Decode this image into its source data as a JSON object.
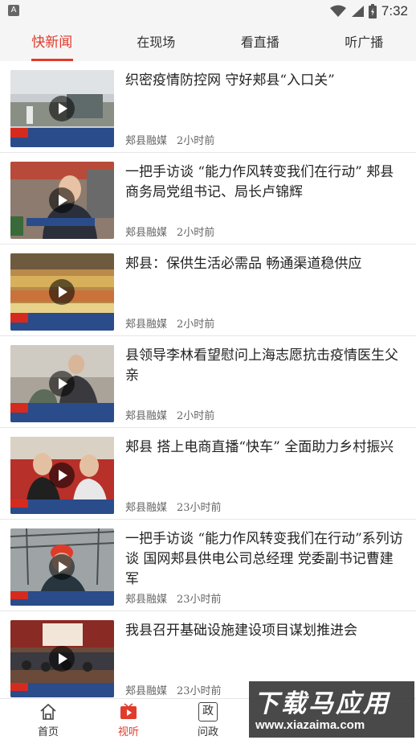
{
  "status_bar": {
    "time": "7:32",
    "left_icon": "A"
  },
  "tabs": [
    {
      "label": "快新闻",
      "active": true
    },
    {
      "label": "在现场",
      "active": false
    },
    {
      "label": "看直播",
      "active": false
    },
    {
      "label": "听广播",
      "active": false
    }
  ],
  "news": [
    {
      "title": "织密疫情防控网 守好郏县“入口关”",
      "source": "郏县融媒",
      "time": "2小时前"
    },
    {
      "title": "一把手访谈 “能力作风转变我们在行动” 郏县商务局党组书记、局长卢锦辉",
      "source": "郏县融媒",
      "time": "2小时前"
    },
    {
      "title": "郏县：保供生活必需品 畅通渠道稳供应",
      "source": "郏县融媒",
      "time": "2小时前"
    },
    {
      "title": "县领导李林看望慰问上海志愿抗击疫情医生父亲",
      "source": "郏县融媒",
      "time": "2小时前"
    },
    {
      "title": " 郏县 搭上电商直播“快车” 全面助力乡村振兴",
      "source": "郏县融媒",
      "time": "23小时前"
    },
    {
      "title": "一把手访谈 “能力作风转变我们在行动”系列访谈 国网郏县供电公司总经理 党委副书记曹建军",
      "source": "郏县融媒",
      "time": "23小时前"
    },
    {
      "title": "我县召开基础设施建设项目谋划推进会",
      "source": "郏县融媒",
      "time": "23小时前"
    }
  ],
  "bottom_nav": [
    {
      "label": "首页",
      "icon": "home-icon"
    },
    {
      "label": "视听",
      "icon": "video-icon",
      "active": true
    },
    {
      "label": "问政",
      "icon": "politics-icon",
      "glyph": "政"
    }
  ],
  "watermark": {
    "main": "下载马应用",
    "url": "www.xiazaima.com"
  },
  "colors": {
    "accent": "#e13b2c",
    "tab_bg": "#f5f5f5",
    "divider": "#e6e6e6"
  }
}
